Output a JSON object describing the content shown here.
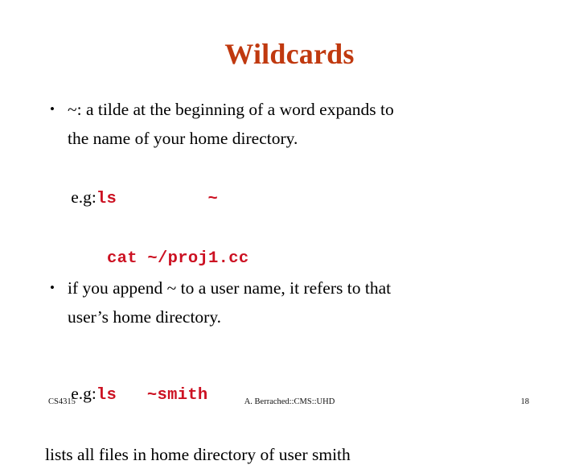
{
  "slide": {
    "title": "Wildcards",
    "title_color": "#C0390F",
    "code_color": "#CC1122",
    "background_color": "#FFFFFF",
    "text_color": "#000000"
  },
  "content": {
    "bullet1": {
      "marker": "•",
      "line1": "~:  a tilde at the beginning of a word expands to",
      "line2": "the name of your home directory."
    },
    "example1": {
      "label": "e.g:",
      "code_line1": "ls         ~",
      "code_line2": "cat ~/proj1.cc"
    },
    "bullet2": {
      "marker": "•",
      "line1": "if you append ~ to a user name, it refers to that",
      "line2": "user’s home directory."
    },
    "example2": {
      "label": "e.g:",
      "code": "ls   ~smith"
    },
    "closing_line": "lists all files in home directory of user smith"
  },
  "footer": {
    "course": "CS4315",
    "attribution": "A. Berrached::CMS::UHD",
    "page_number": "18"
  }
}
